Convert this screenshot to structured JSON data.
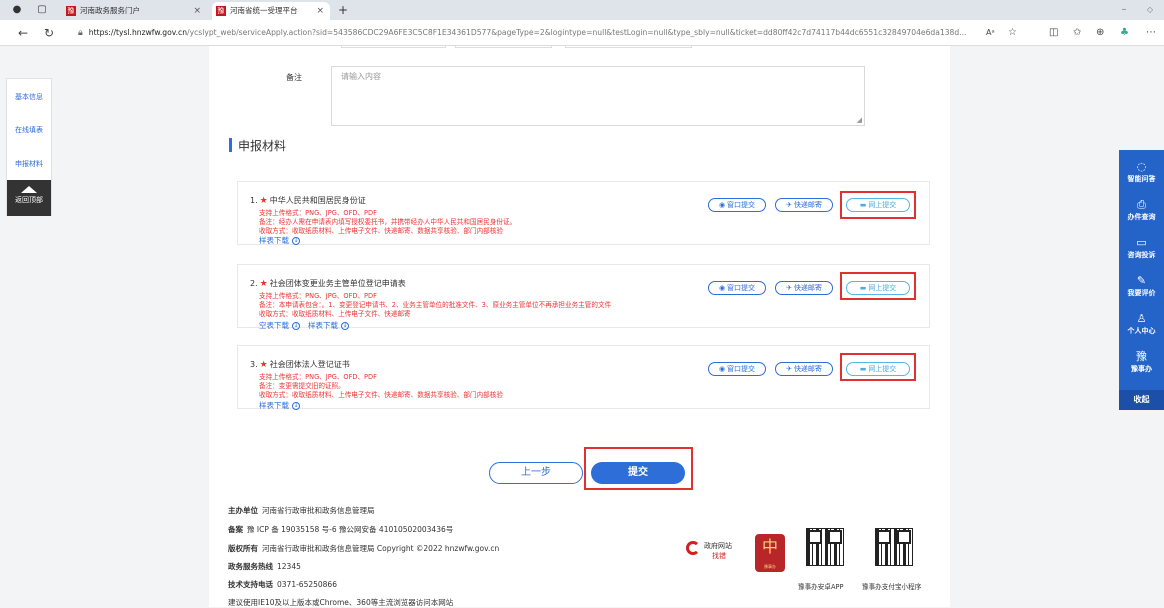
{
  "browser": {
    "tabs": [
      {
        "title": "河南政务服务门户",
        "flag": "豫"
      },
      {
        "title": "河南省统一受理平台",
        "flag": "豫"
      }
    ],
    "new_tab": "+",
    "url_host": "https://tysl.hnzwfw.gov.cn",
    "url_path": "/ycslypt_web/serviceApply.action?sid=543586CDC29A6FE3C5C8F1E34361D577&pageType=2&logintype=null&testLogin=null&type_sbly=null&ticket=dd80ff42c7d74117b44dc6551c32849704e6da138d...",
    "read_aloud": "Aᵃ"
  },
  "left_nav": {
    "items": [
      "基本信息",
      "在线填表",
      "申报材料"
    ],
    "back": "返回顶部"
  },
  "remark": {
    "label": "备注",
    "placeholder": "请输入内容"
  },
  "section_title": "申报材料",
  "materials": [
    {
      "no": "1.",
      "title": "中华人民共和国居民身份证",
      "formats": "支持上传格式：PNG、JPG、OFD、PDF",
      "note": "备注：经办人需在申请表内填写授权委托书，并携带经办人中华人民共和国居民身份证。",
      "ways": "收取方式：收取纸质材料、上传电子文件、快递邮寄、数据共享核验、部门内部核验",
      "links": [
        "样表下载"
      ]
    },
    {
      "no": "2.",
      "title": "社会团体变更业务主管单位登记申请表",
      "formats": "支持上传格式：PNG、JPG、OFD、PDF",
      "note": "备注：本申请表包含：。1、变更登记申请书、2、业务主管单位的批准文件、3、原业务主管单位不再承担业务主管的文件",
      "ways": "收取方式：收取纸质材料、上传电子文件、快递邮寄",
      "links": [
        "空表下载",
        "样表下载"
      ]
    },
    {
      "no": "3.",
      "title": "社会团体法人登记证书",
      "formats": "支持上传格式：PNG、JPG、OFD、PDF",
      "note": "备注：变更需提交旧的证照。",
      "ways": "收取方式：收取纸质材料、上传电子文件、快递邮寄、数据共享核验、部门内部核验",
      "links": [
        "样表下载"
      ]
    }
  ],
  "submit_options": {
    "window": "窗口提交",
    "express": "快递邮寄",
    "online": "网上提交"
  },
  "actions": {
    "prev": "上一步",
    "submit": "提交"
  },
  "footer": {
    "rows": [
      {
        "label": "主办单位",
        "value": "河南省行政审批和政务信息管理局"
      },
      {
        "label": "备案",
        "value": "豫 ICP 备 19035158 号-6   豫公网安备 41010502003436号"
      },
      {
        "label": "版权所有",
        "value": "河南省行政审批和政务信息管理局 Copyright ©2022 hnzwfw.gov.cn"
      },
      {
        "label": "政务服务热线",
        "value": "12345"
      },
      {
        "label": "技术支持电话",
        "value": "0371-65250866"
      },
      {
        "label": "",
        "value": "建议使用IE10及以上版本或Chrome、360等主流浏览器访问本网站"
      }
    ],
    "gov_badge_top": "政府网站",
    "gov_badge_bottom": "找错",
    "emblem_text": "豫事办",
    "qr_captions": [
      "豫事办安卓APP",
      "豫事办支付宝小程序"
    ]
  },
  "right_sidebar": {
    "items": [
      "智能问答",
      "办件查询",
      "咨询投诉",
      "我要评价",
      "个人中心",
      "豫事办"
    ],
    "fold": "收起"
  },
  "colors": {
    "primary": "#2d6ed8",
    "sidebar": "#2463c8",
    "required": "#e23a2a",
    "highlight_box": "#e03030"
  }
}
